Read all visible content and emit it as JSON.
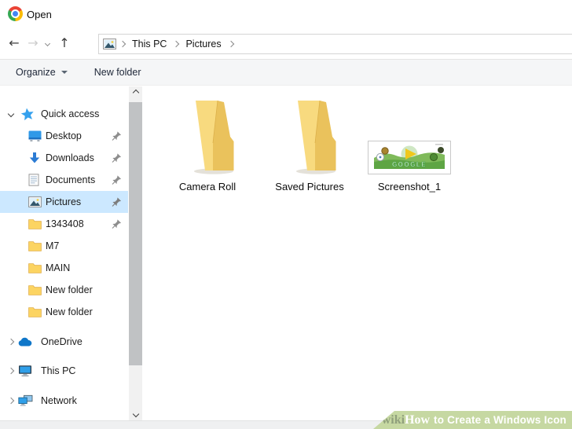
{
  "colors": {
    "selection_blue": "#cce8ff",
    "folder_yellow": "#eac25c",
    "folder_yellow_light": "#f8da7f",
    "toolbar_bg": "#f5f6f7",
    "banner_green": "#c6d8a2",
    "accent_blue": "#2b7bd4"
  },
  "window": {
    "title": "Open"
  },
  "icons": {
    "back": "←",
    "forward": "→",
    "up": "↑"
  },
  "nav": {
    "crumbs": [
      "This PC",
      "Pictures"
    ]
  },
  "toolbar": {
    "organize": "Organize",
    "new_folder": "New folder"
  },
  "sidebar": {
    "quick_access": "Quick access",
    "items": [
      {
        "label": "Desktop",
        "icon": "desktop-icon",
        "pinned": true
      },
      {
        "label": "Downloads",
        "icon": "downloads-icon",
        "pinned": true
      },
      {
        "label": "Documents",
        "icon": "document-icon",
        "pinned": true
      },
      {
        "label": "Pictures",
        "icon": "pictures-icon",
        "pinned": true,
        "selected": true
      },
      {
        "label": "1343408",
        "icon": "folder-icon",
        "pinned": true
      },
      {
        "label": "M7",
        "icon": "folder-icon",
        "pinned": false
      },
      {
        "label": "MAIN",
        "icon": "folder-icon",
        "pinned": false
      },
      {
        "label": "New folder",
        "icon": "folder-icon",
        "pinned": false
      },
      {
        "label": "New folder",
        "icon": "folder-icon",
        "pinned": false
      }
    ],
    "sections": [
      {
        "label": "OneDrive",
        "icon": "onedrive-icon"
      },
      {
        "label": "This PC",
        "icon": "thispc-icon"
      },
      {
        "label": "Network",
        "icon": "network-icon"
      }
    ]
  },
  "files": [
    {
      "label": "Camera Roll",
      "type": "folder"
    },
    {
      "label": "Saved Pictures",
      "type": "folder"
    },
    {
      "label": "Screenshot_1",
      "type": "image"
    }
  ],
  "thumbnail": {
    "doodle_text": "GOOGLE"
  },
  "watermark": {
    "wiki": "wiki",
    "how": "How",
    "rest": "to Create a Windows Icon"
  }
}
